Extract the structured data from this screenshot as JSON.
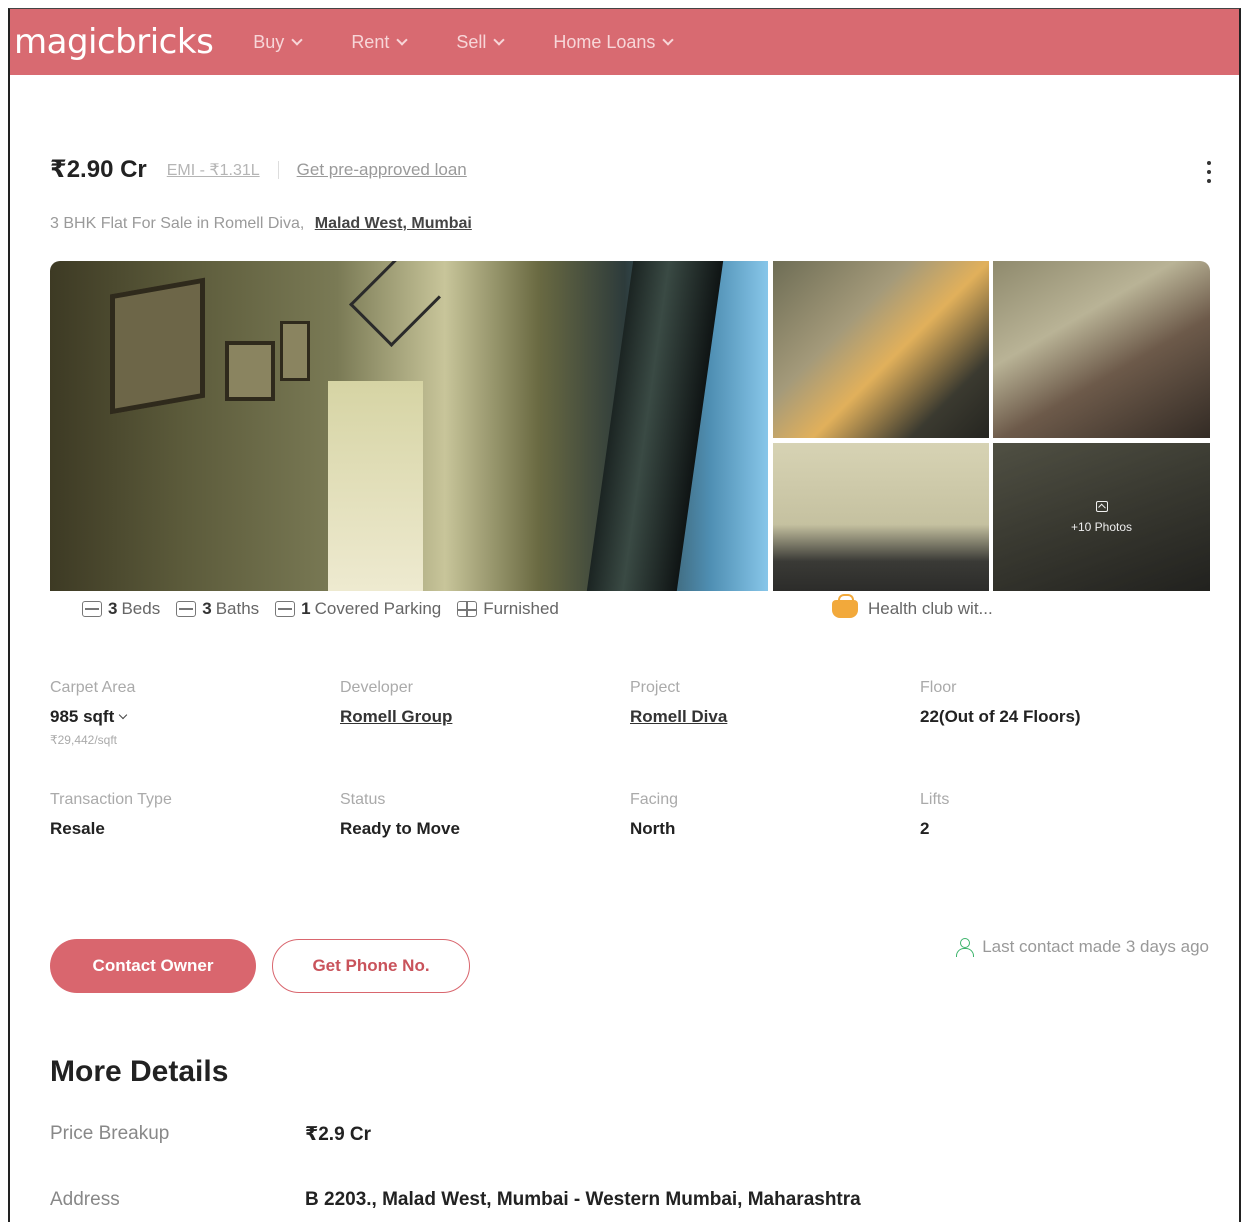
{
  "header": {
    "logo": "magicbricks",
    "nav": [
      {
        "label": "Buy"
      },
      {
        "label": "Rent"
      },
      {
        "label": "Sell"
      },
      {
        "label": "Home Loans"
      }
    ]
  },
  "listing": {
    "price": "₹2.90 Cr",
    "emi_link": "EMI - ₹1.31L",
    "separator": "|",
    "preapproved_link": "Get pre-approved loan",
    "subtitle": "3 BHK Flat For Sale in Romell Diva,",
    "location": "Malad West, Mumbai"
  },
  "gallery": {
    "more_photos": "+10 Photos"
  },
  "amenities": {
    "beds_count": "3",
    "beds_label": "Beds",
    "baths_count": "3",
    "baths_label": "Baths",
    "parking_count": "1",
    "parking_label": "Covered Parking",
    "furnished_label": "Furnished",
    "health_club": "Health club wit..."
  },
  "summary": {
    "carpet_area_label": "Carpet Area",
    "carpet_area_value": "985 sqft",
    "carpet_area_rate": "₹29,442/sqft",
    "developer_label": "Developer",
    "developer_value": "Romell Group",
    "project_label": "Project",
    "project_value": "Romell Diva",
    "floor_label": "Floor",
    "floor_value": "22(Out of 24 Floors)",
    "transaction_label": "Transaction Type",
    "transaction_value": "Resale",
    "status_label": "Status",
    "status_value": "Ready to Move",
    "facing_label": "Facing",
    "facing_value": "North",
    "lifts_label": "Lifts",
    "lifts_value": "2"
  },
  "cta": {
    "contact_owner": "Contact Owner",
    "get_phone": "Get Phone No.",
    "last_contact": "Last contact made 3 days ago"
  },
  "more_details": {
    "title": "More Details",
    "price_breakup_label": "Price Breakup",
    "price_breakup_value": "₹2.9 Cr",
    "address_label": "Address",
    "address_value": "B 2203., Malad West, Mumbai - Western Mumbai, Maharashtra"
  },
  "colors": {
    "brand": "#d86a71",
    "cta": "#d9666e",
    "health_icon": "#f2a93b",
    "contact_icon": "#3bb36a"
  },
  "icons": [
    "chevron-down-icon",
    "more-options-icon",
    "bed-icon",
    "bath-icon",
    "parking-icon",
    "furnished-icon",
    "health-club-icon",
    "photo-icon",
    "person-icon"
  ]
}
